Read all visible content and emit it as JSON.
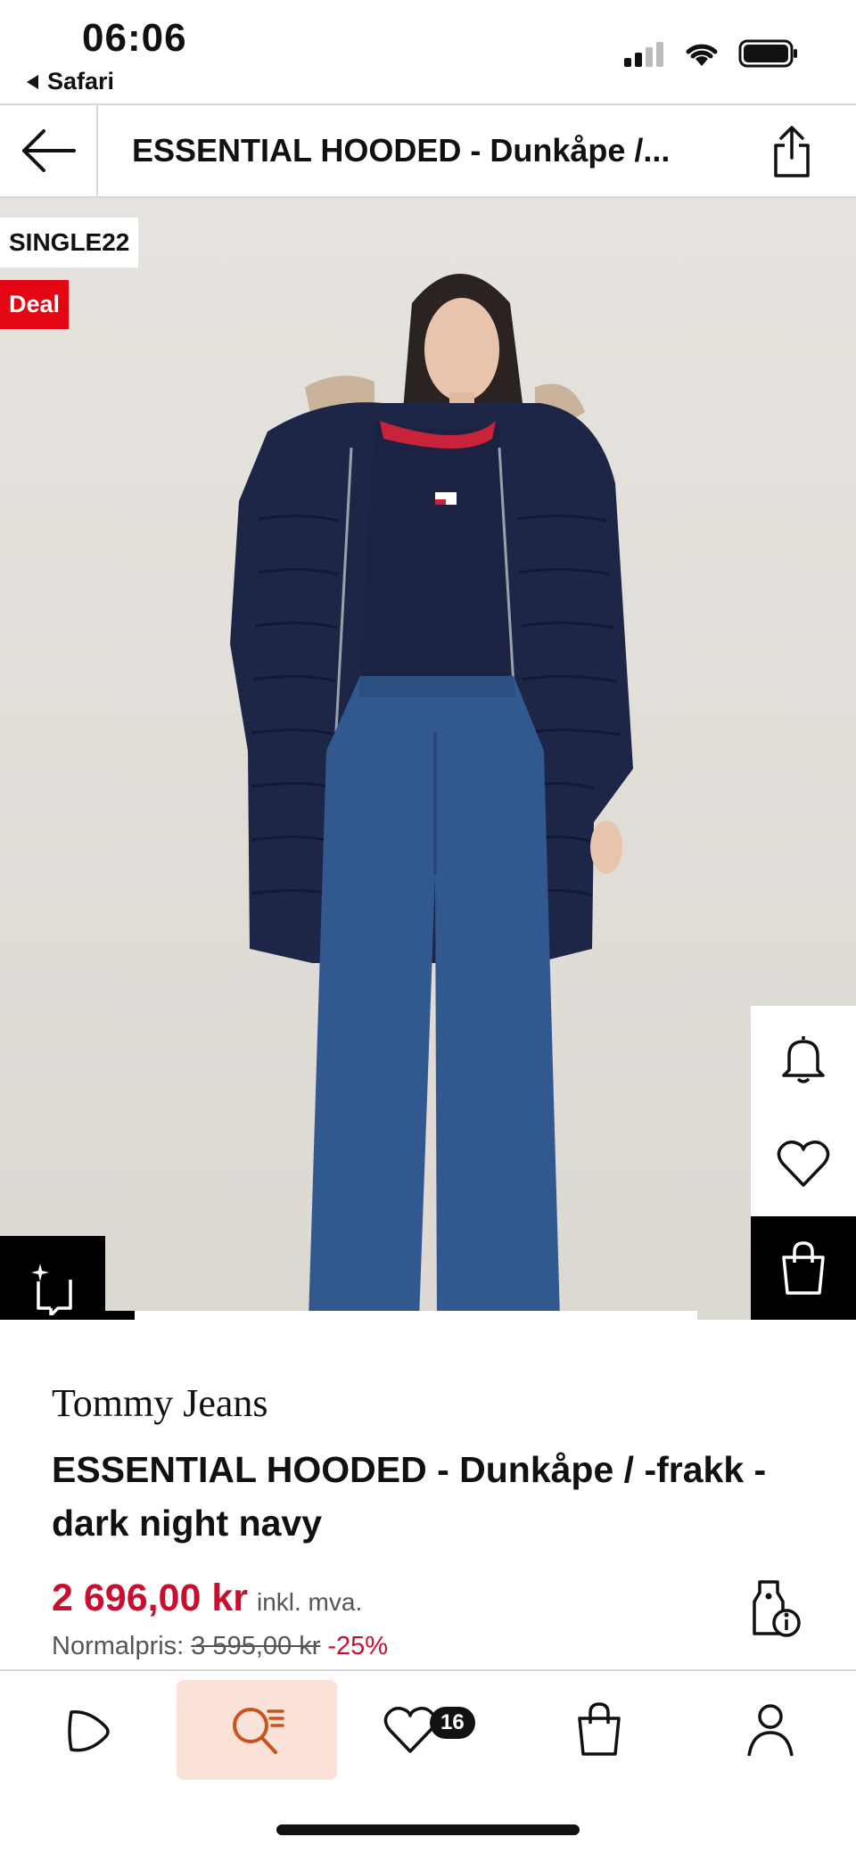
{
  "status_bar": {
    "time": "06:06",
    "back_app": "Safari"
  },
  "header": {
    "title": "ESSENTIAL HOODED  - Dunkåpe /..."
  },
  "image": {
    "badge_code": "SINGLE22",
    "badge_deal": "Deal",
    "deal_color": "#e30613",
    "carousel_progress_fraction": 0.05
  },
  "product": {
    "brand": "Tommy Jeans",
    "name": "ESSENTIAL HOODED  - Dunkåpe / -frakk - dark night navy",
    "price": "2 696,00 kr",
    "vat": "inkl. mva.",
    "normal_label": "Normalpris:",
    "normal_price": "3 595,00 kr",
    "discount": "-25%",
    "price_color": "#c8102e"
  },
  "nav": {
    "items": [
      "home-icon",
      "search-icon",
      "wishlist-icon",
      "bag-icon",
      "profile-icon"
    ],
    "wishlist_count": "16",
    "active_color": "#fbe2d8"
  }
}
